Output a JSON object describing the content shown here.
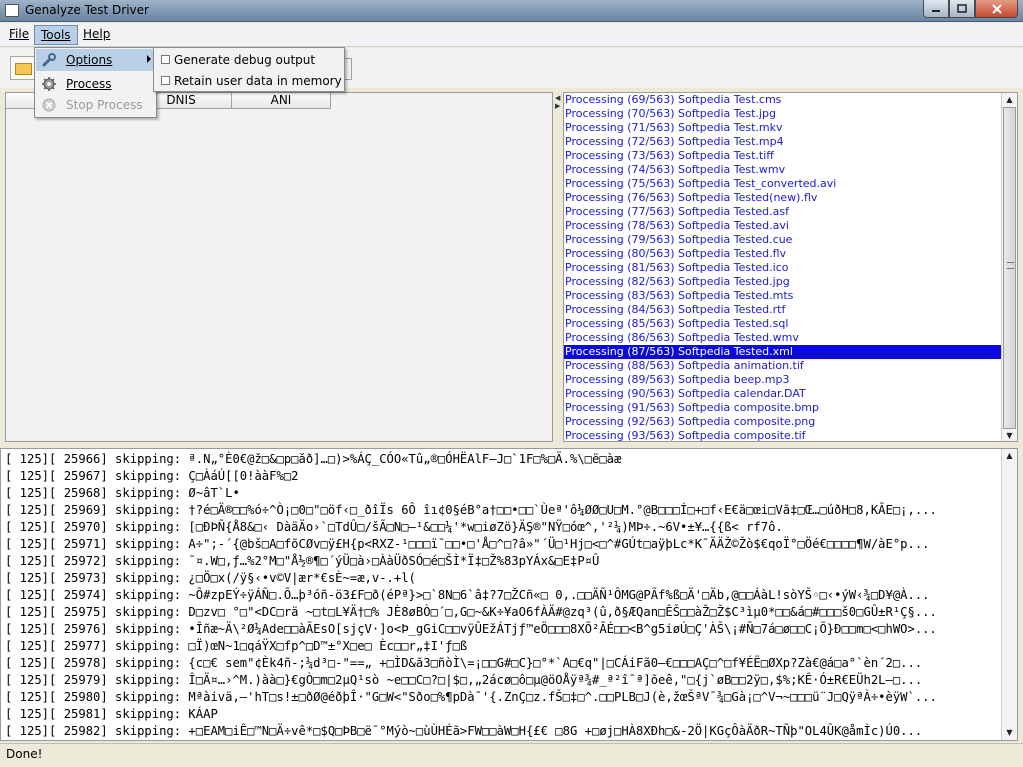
{
  "window": {
    "title": "Genalyze Test Driver",
    "controls": [
      "minimize",
      "maximize",
      "close"
    ]
  },
  "menubar": {
    "items": [
      {
        "label": "File"
      },
      {
        "label": "Tools"
      },
      {
        "label": "Help"
      }
    ],
    "active": "Tools"
  },
  "tools_menu": {
    "items": [
      {
        "label": "Options",
        "icon": "wrench-icon",
        "has_submenu": true,
        "highlighted": true
      },
      {
        "label": "Process",
        "icon": "gear-icon",
        "enabled": true
      },
      {
        "label": "Stop Process",
        "icon": "stop-icon",
        "enabled": false
      }
    ]
  },
  "options_submenu": {
    "items": [
      {
        "label": "Generate debug output",
        "checked": false
      },
      {
        "label": "Retain user data in memory",
        "checked": false
      }
    ]
  },
  "table": {
    "columns": [
      "DNIS",
      "ANI"
    ]
  },
  "processing_list": {
    "selected_index": 18,
    "lines": [
      "Processing (69/563) Softpedia Test.cms",
      "Processing (70/563) Softpedia Test.jpg",
      "Processing (71/563) Softpedia Test.mkv",
      "Processing (72/563) Softpedia Test.mp4",
      "Processing (73/563) Softpedia Test.tiff",
      "Processing (74/563) Softpedia Test.wmv",
      "Processing (75/563) Softpedia Test_converted.avi",
      "Processing (76/563) Softpedia Tested(new).flv",
      "Processing (77/563) Softpedia Tested.asf",
      "Processing (78/563) Softpedia Tested.avi",
      "Processing (79/563) Softpedia Tested.cue",
      "Processing (80/563) Softpedia Tested.flv",
      "Processing (81/563) Softpedia Tested.ico",
      "Processing (82/563) Softpedia Tested.jpg",
      "Processing (83/563) Softpedia Tested.mts",
      "Processing (84/563) Softpedia Tested.rtf",
      "Processing (85/563) Softpedia Tested.sql",
      "Processing (86/563) Softpedia Tested.wmv",
      "Processing (87/563) Softpedia Tested.xml",
      "Processing (88/563) Softpedia animation.tif",
      "Processing (89/563) Softpedia beep.mp3",
      "Processing (90/563) Softpedia calendar.DAT",
      "Processing (91/563) Softpedia composite.bmp",
      "Processing (92/563) Softpedia composite.png",
      "Processing (93/563) Softpedia composite.tif"
    ]
  },
  "log": {
    "lines": [
      "[ 125][ 25966] skipping: ª.N„°È0€@ž□&□p□ăð]…□)>%ÁÇ_CÓO«Tû„®□ÓHËAlF—J□`1F□%□Ä.%\\□ë□àæ",
      "[ 125][ 25967] skipping: Ç□ÀáÚ[[0!ààF%□2",
      "[ 125][ 25968] skipping: Ø~âT`L•",
      "[ 125][ 25969] skipping: †?é□Ä®□□%ó÷^Ò¡□0□\"□öf‹□_ðîÏs 6Ô îı¢0§éB°a†□□•□□`Ùeª'ô¼ØØ□U□M.°@B□□□Í□+□f‹E€ä□œi□Vã‡□Œ…□úðH□8,KÃE□¡,...",
      "[ 125][ 25970] skipping: [□ÐÞÑ{Å8&□‹ DàäÄo›`□TdÛ□/šÃ□N□—¹&□□¼'*w□iøZö}ÄŞ®\"NŸ□óœ^,'²¼)MÞ÷.~6V•±¥…{{ß< rf7ô.",
      "[ 125][ 25971] skipping: A÷\";-´{@bš□A□fõCØv□ÿ£H{p<RXZ-¹□□□ï¯□□•□'Å□^□?â»\"´Ü□¹Hj□<□^#GÚt□aÿþLc*K¯ÄÄŽ©Žò$€qoÏ°□Öé€□□□□¶W/àE°p...",
      "[ 125][ 25972] skipping: ¯¤.W□,ƒ…%2°M□\"Å½®¶□´ýÜ□à›□ÀàÜðSÓ□é□ŠÌ*Ï‡□Ž%83pYÁx&□E‡P¤Û",
      "[ 125][ 25973] skipping: ¿□Ö□x(/ÿ§‹•v©V|ær*€sÈ~=æ,v-.+l(",
      "[ 125][ 25974] skipping: ~Õ#zpEÝ÷ÿÁÑ□.Õ…þ³óñ-ö3£F□ð(éPª}>□`8N□6`â‡?7□ŽCñ«□ 0,.□□ÄÑ¹ÔMG@PÃf%ß□Ä'□Äb,@□□ÁàL!sòYŠ◦□‹•ýW‹¾□D¥@À...",
      "[ 125][ 25975] skipping: D□zv□ °□\"<DC□rä ~□t□L¥Ä†□% JÈ8øBÒ□´□,G□~&K÷¥aO6fÀÄ#@zq³(û,ð§ÆQan□ÊŠ□□àŽ□Ž$C³ìµ0*□□&á□#□□□š0□GÛ±R¹Ç§...",
      "[ 125][ 25976] skipping: •Îñæ~Ä\\²Ø¼Ade□□àÃEsO[sjçV·]o<Þ_gGiC□□vÿÛEžÁTjƒ™eÖ□□□8XÕ²ÃÉ□□<B^g5iøÚ□Ç'ÀŠ\\¡#Ñ□7á□ø□□C¡Õ}Ð□□m□<□hWO>...",
      "[ 125][ 25977] skipping: □Ï)œN~1□qáŸX□fp^□D™±°X□e□ Èc□□r„‡I'ƒ□ß",
      "[ 125][ 25978] skipping: {c□€ sem\"¢Èk4ñ-;¼d³□-\"==„ +□ÌD&ã3□ñòÌ\\=¡□□G#□C}□°*`A□€q\"|□CÁiFã0—€□□□AÇ□^□f¥ÉË□ØXp?Zà€@á□a°`èn´2□...",
      "[ 125][ 25979] skipping: Î□Ä¤…›^M.)àà□}€gÒ□m□2µQ¹sò ~e□□C□?□|$□,„2ácø□ô□µ@öOÅÿª¾#_ª²î¯ª]õeê,\"□{j`øB□□2ÿ□,$%;KÊ·Ó±R€EÜh2L—□...",
      "[ 125][ 25980] skipping: Mªàivä,–'hT□s!±□ðØ@éðþÎ·\"G□W<\"Sðo□%¶pDà¯'{.ZnÇ□z.fŠ□‡□^.□□PLB□J(è,žœŠªV¯¾□Gà¡□^V¬~□□□ü¨J□QÿªÀ÷•èÿW`...",
      "[ 125][ 25981] skipping: KÁAP",
      "[ 125][ 25982] skipping: +□EAM□iÊ□™N□Ä÷vê*□$Q□ÞB□ë¯°Mýò~□ùÙHÉã>FW□□àW□H{£€ □8G +□øj□HÀ8XÐh□&-2Ö|KGçÔàÄðR~TÑþ\"OL4ÛK@åmÌc)Ú0..."
    ]
  },
  "status": {
    "text": "Done!"
  },
  "colors": {
    "list_text": "#1a1ad6",
    "selection": "#0a0ae0",
    "menu_highlight": "#b8cfe5"
  }
}
